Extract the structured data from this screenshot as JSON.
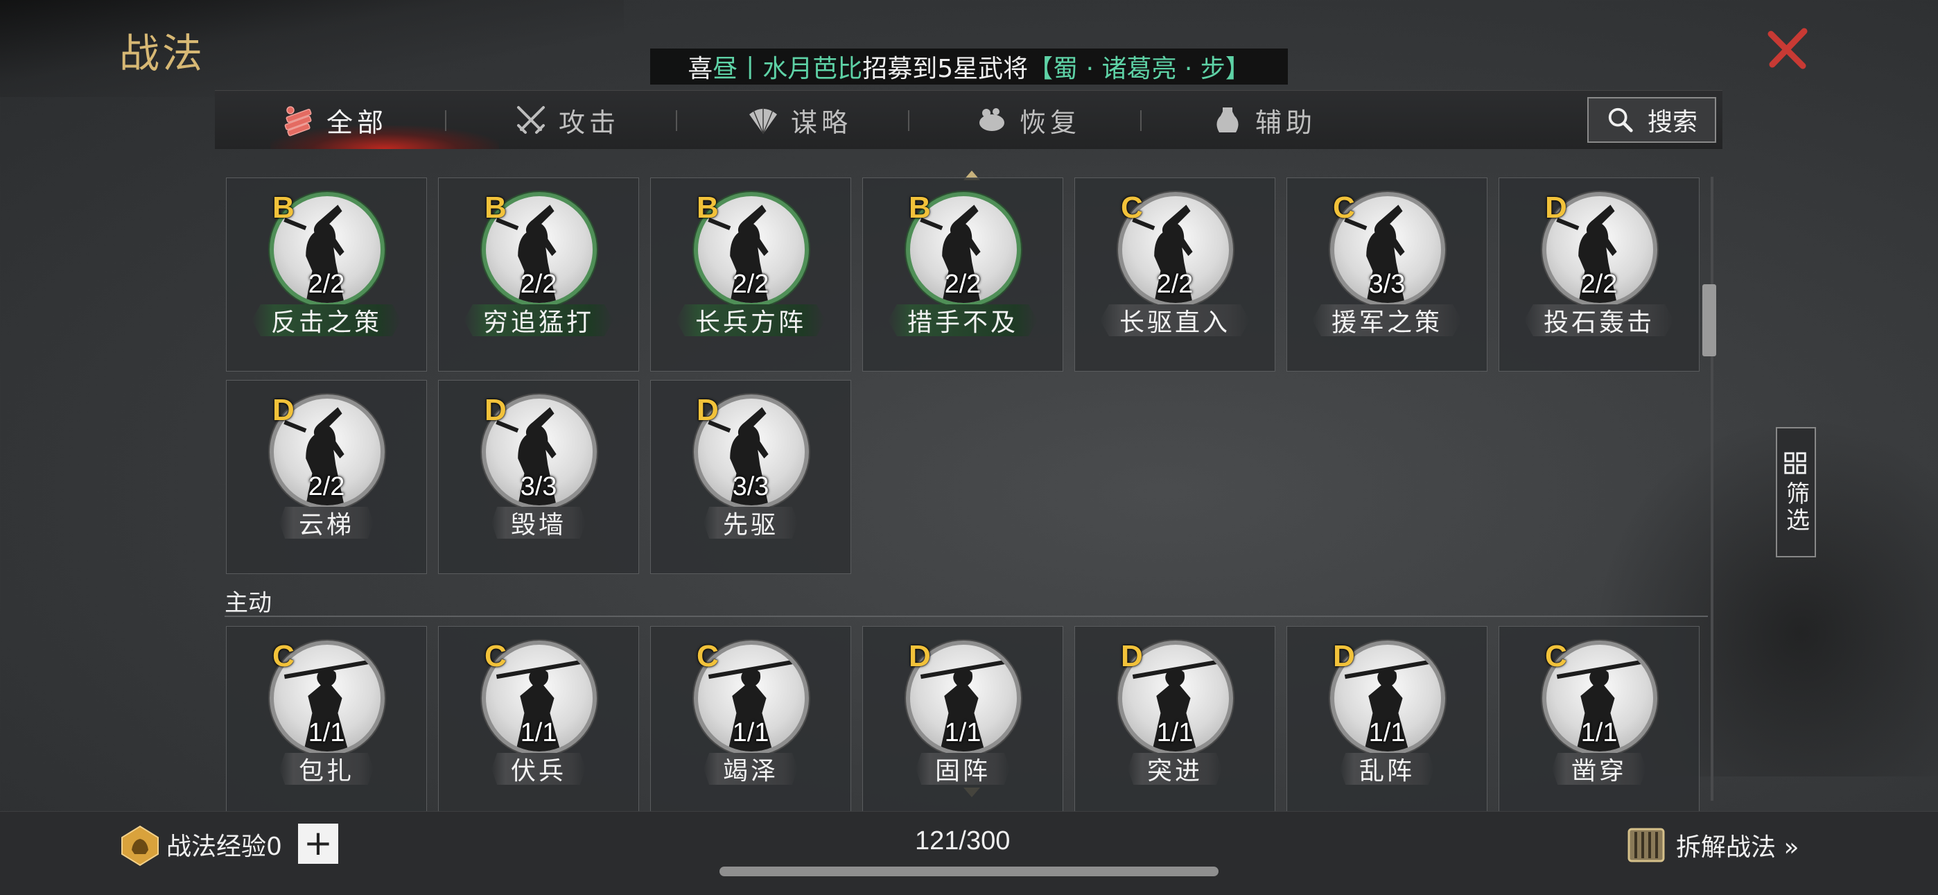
{
  "header": {
    "title": "战法",
    "broadcast": {
      "part1": "喜",
      "part2": "昼丨水月芭比",
      "part3": "招募到5星武将",
      "part4": "【蜀 · 诸葛亮 · 步】"
    }
  },
  "tabs": [
    {
      "label": "全部",
      "icon": "all-tactics-icon",
      "active": true
    },
    {
      "label": "攻击",
      "icon": "crossed-swords-icon"
    },
    {
      "label": "谋略",
      "icon": "fan-icon"
    },
    {
      "label": "恢复",
      "icon": "recovery-icon"
    },
    {
      "label": "辅助",
      "icon": "support-icon"
    }
  ],
  "search": {
    "label": "搜索"
  },
  "passive_tactics": [
    {
      "grade": "B",
      "count": "2/2",
      "name": "反击之策",
      "style": "green"
    },
    {
      "grade": "B",
      "count": "2/2",
      "name": "穷追猛打",
      "style": "green"
    },
    {
      "grade": "B",
      "count": "2/2",
      "name": "长兵方阵",
      "style": "green"
    },
    {
      "grade": "B",
      "count": "2/2",
      "name": "措手不及",
      "style": "green"
    },
    {
      "grade": "C",
      "count": "2/2",
      "name": "长驱直入",
      "style": "gray"
    },
    {
      "grade": "C",
      "count": "3/3",
      "name": "援军之策",
      "style": "gray"
    },
    {
      "grade": "D",
      "count": "2/2",
      "name": "投石轰击",
      "style": "gray"
    },
    {
      "grade": "D",
      "count": "2/2",
      "name": "云梯",
      "style": "gray"
    },
    {
      "grade": "D",
      "count": "3/3",
      "name": "毁墙",
      "style": "gray"
    },
    {
      "grade": "D",
      "count": "3/3",
      "name": "先驱",
      "style": "gray"
    }
  ],
  "active_section": {
    "label": "主动"
  },
  "active_tactics": [
    {
      "grade": "C",
      "count": "1/1",
      "name": "包扎",
      "style": "gray"
    },
    {
      "grade": "C",
      "count": "1/1",
      "name": "伏兵",
      "style": "gray"
    },
    {
      "grade": "C",
      "count": "1/1",
      "name": "竭泽",
      "style": "gray"
    },
    {
      "grade": "D",
      "count": "1/1",
      "name": "固阵",
      "style": "gray"
    },
    {
      "grade": "D",
      "count": "1/1",
      "name": "突进",
      "style": "gray"
    },
    {
      "grade": "D",
      "count": "1/1",
      "name": "乱阵",
      "style": "gray"
    },
    {
      "grade": "C",
      "count": "1/1",
      "name": "凿穿",
      "style": "gray"
    }
  ],
  "filter": {
    "label": "筛选"
  },
  "footer": {
    "exp_label": "战法经验0",
    "plus": "+",
    "capacity": "121/300",
    "dismantle_label": "拆解战法 »"
  },
  "colors": {
    "gold": "#d7b874",
    "grade": "#f2c23a",
    "broadcast_green": "#5ed2a6",
    "close_red": "#c83a34",
    "tab_glow": "#d7281e"
  }
}
